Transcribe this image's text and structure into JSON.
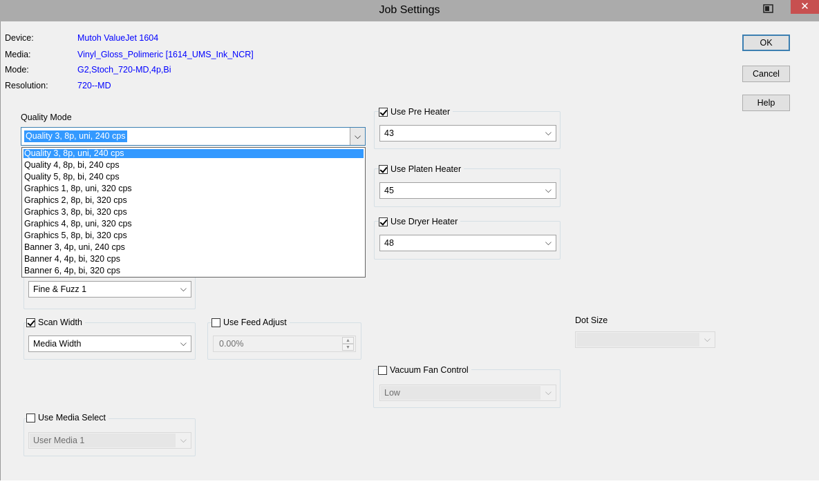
{
  "window": {
    "title": "Job Settings",
    "close_glyph": "✕"
  },
  "info": {
    "device_label": "Device:",
    "device_value": "Mutoh ValueJet 1604",
    "media_label": "Media:",
    "media_value": "Vinyl_Gloss_Polimeric [1614_UMS_Ink_NCR]",
    "mode_label": "Mode:",
    "mode_value": "G2,Stoch_720-MD,4p,Bi",
    "resolution_label": "Resolution:",
    "resolution_value": "720--MD"
  },
  "buttons": {
    "ok": "OK",
    "cancel": "Cancel",
    "help": "Help"
  },
  "quality_mode": {
    "label": "Quality Mode",
    "selected": "Quality 3, 8p, uni, 240 cps",
    "options": [
      "Quality 3, 8p, uni, 240 cps",
      "Quality 4, 8p, bi, 240 cps",
      "Quality 5, 8p, bi, 240 cps",
      "Graphics 1, 8p, uni, 320 cps",
      "Graphics 2, 8p, bi, 320 cps",
      "Graphics 3, 8p, bi, 320 cps",
      "Graphics 4, 8p, uni, 320 cps",
      "Graphics 5, 8p, bi, 320 cps",
      "Banner 3, 4p, uni, 240 cps",
      "Banner 4, 4p, bi, 320 cps",
      "Banner 6, 4p, bi, 320 cps"
    ],
    "highlighted_index": 0
  },
  "fine_fuzz": {
    "value": "Fine & Fuzz 1"
  },
  "scan_width": {
    "label": "Scan Width",
    "checked": true,
    "value": "Media Width"
  },
  "feed_adjust": {
    "label": "Use Feed Adjust",
    "checked": false,
    "value": "0.00%"
  },
  "media_select": {
    "label": "Use Media Select",
    "checked": false,
    "value": "User Media 1"
  },
  "pre_heater": {
    "label": "Use Pre Heater",
    "checked": true,
    "value": "43"
  },
  "platen_heater": {
    "label": "Use Platen Heater",
    "checked": true,
    "value": "45"
  },
  "dryer_heater": {
    "label": "Use Dryer Heater",
    "checked": true,
    "value": "48"
  },
  "vacuum_fan": {
    "label": "Vacuum Fan Control",
    "checked": false,
    "value": "Low"
  },
  "dot_size": {
    "label": "Dot Size",
    "value": ""
  },
  "glyphs": {
    "combo_arrow": "⌵",
    "spin_up": "▲",
    "spin_down": "▼"
  }
}
